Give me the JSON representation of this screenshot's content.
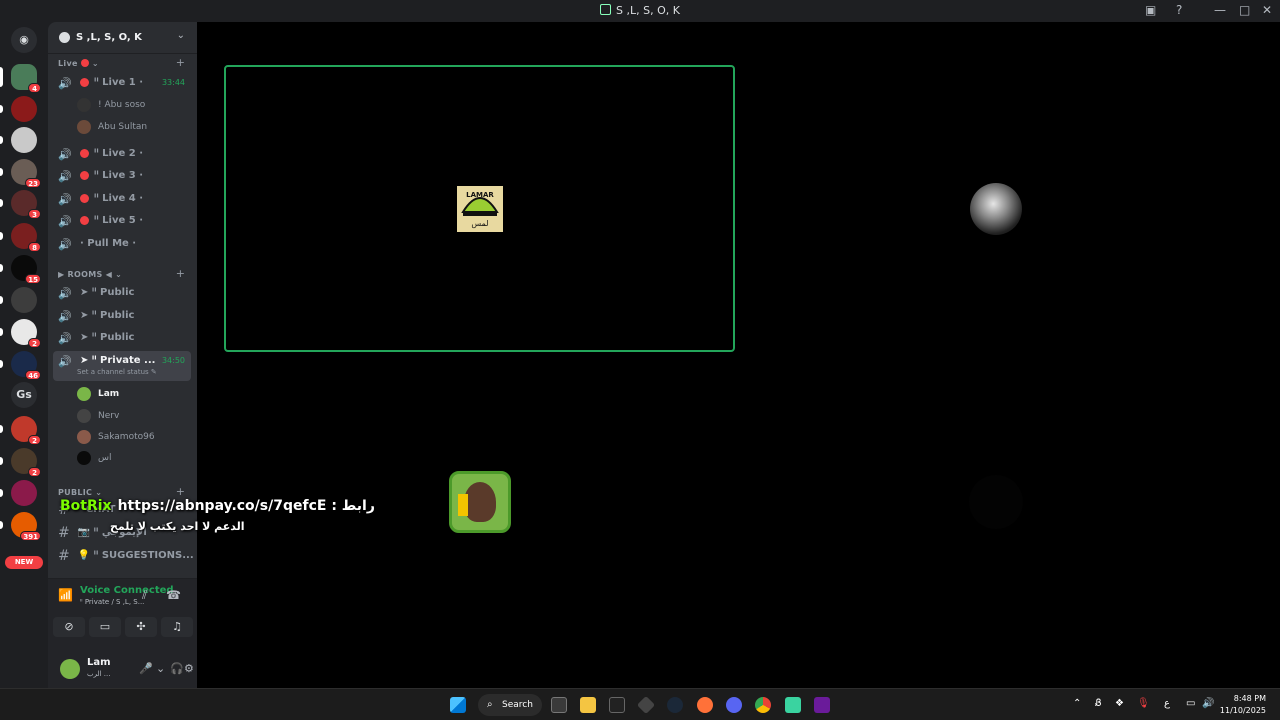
{
  "window": {
    "title": "S ,L, S, O, K"
  },
  "server": {
    "name": "S ,L, S, O, K",
    "categories": {
      "live": "Live",
      "rooms": "ROOMS ◀",
      "public": "PUBLIC"
    }
  },
  "rail": {
    "badges": [
      "4",
      "23",
      "3",
      "8",
      "15",
      "2",
      "46",
      "2",
      "2",
      "391"
    ],
    "gs_label": "Gs",
    "new_label": "NEW"
  },
  "channels": {
    "live1": {
      "name": "Live 1",
      "time": "33:44"
    },
    "live1_users": [
      "! Abu soso",
      "Abu Sultan"
    ],
    "live2": {
      "name": "Live 2"
    },
    "live3": {
      "name": "Live 3"
    },
    "live4": {
      "name": "Live 4"
    },
    "live5": {
      "name": "Live 5"
    },
    "pullme": {
      "name": "Pull Me"
    },
    "rooms": [
      "Public",
      "Public",
      "Public"
    ],
    "private": {
      "name": "Private ...",
      "time": "34:50",
      "status": "Set a channel status"
    },
    "private_users": [
      "Lam",
      "Nerv",
      "Sakamoto96",
      "اس"
    ],
    "text_channels": [
      "CHAT",
      "الإيموجي",
      "SUGGESTIONS..."
    ]
  },
  "voice": {
    "status": "Voice Connected",
    "channel": "Private / S ,L, S..."
  },
  "user": {
    "name": "Lam",
    "status": "الرب ..."
  },
  "overlay": {
    "bot": "BotRix",
    "line1": "https://abnpay.co/s/7qefcE : رابط",
    "line2": "الدعم لا احد يكتب لا تلمح"
  },
  "taskbar": {
    "search": "Search",
    "time": "8:48 PM",
    "date": "11/10/2025",
    "lang": "ع"
  },
  "colors": {
    "accent_green": "#23a55a",
    "tile1": "#e8d9a0",
    "tile2": "#cfcfcf",
    "tile3": "#2b1b19",
    "badge_red": "#f23f43"
  }
}
